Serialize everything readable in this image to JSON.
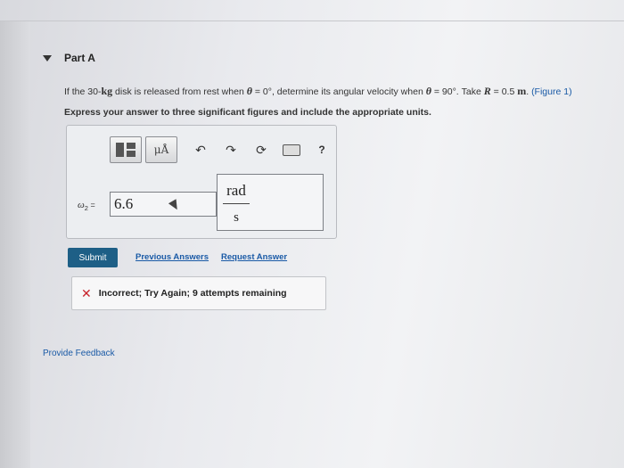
{
  "part": {
    "label": "Part A"
  },
  "question": {
    "t1": "If the 30-",
    "t2": "kg",
    "t3": " disk is released from rest when ",
    "t4": "θ",
    "t5": " = 0°, determine its angular velocity when ",
    "t6": "θ",
    "t7": " = 90°. Take ",
    "t8": "R",
    "t9": " = 0.5 ",
    "t10": "m",
    "t11": ".",
    "figure_link": "(Figure 1)"
  },
  "instruction": "Express your answer to three significant figures and include the appropriate units.",
  "toolbar": {
    "units_label": "μÅ",
    "help_label": "?"
  },
  "answer": {
    "label_var": "ω",
    "label_sub": "2",
    "label_eq": " =",
    "value": "6.6",
    "unit_numerator": "rad",
    "unit_denominator": "s"
  },
  "actions": {
    "submit": "Submit",
    "previous_answers": "Previous Answers",
    "request_answer": "Request Answer"
  },
  "feedback": {
    "message": "Incorrect; Try Again; 9 attempts remaining"
  },
  "footer": {
    "provide_feedback": "Provide Feedback"
  },
  "colors": {
    "link": "#1a5aa6",
    "submit_bg": "#1e5f86",
    "error": "#c8232c"
  }
}
